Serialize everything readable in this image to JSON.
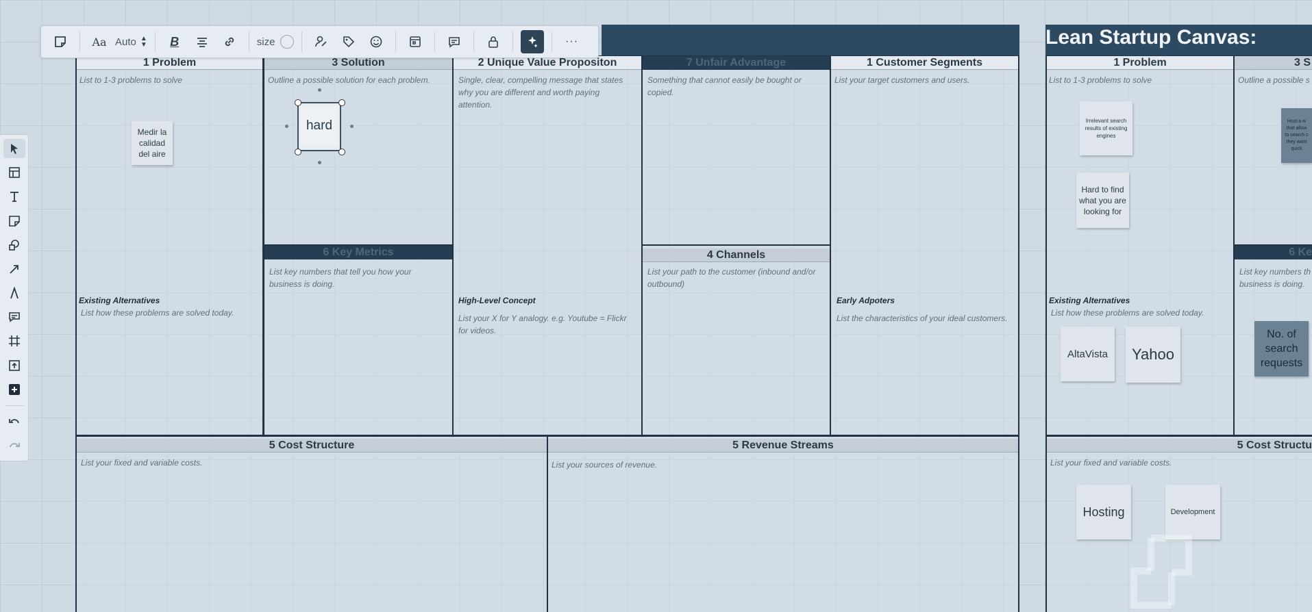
{
  "toolbar": {
    "font_label": "Aa",
    "auto_label": "Auto",
    "bold_label": "B",
    "size_label": "size",
    "more_label": "···"
  },
  "canvas_left": {
    "problem": {
      "title": "1 Problem",
      "hint": "List to 1-3 problems to solve"
    },
    "solution": {
      "title": "3 Solution",
      "hint": "Outline a possible solution for each problem."
    },
    "uvp": {
      "title": "2 Unique Value Propositon",
      "hint": "Single, clear, compelling message that states why  you are different and worth paying attention."
    },
    "unfair": {
      "title": "7 Unfair Advantage",
      "hint": "Something that cannot easily be bought or copied."
    },
    "segments": {
      "title": "1 Customer Segments",
      "hint": "List your target customers and users."
    },
    "metrics": {
      "title": "6 Key Metrics",
      "hint": "List key numbers that tell you how your business is doing."
    },
    "channels": {
      "title": "4 Channels",
      "hint": "List your path to the customer (inbound and/or outbound)"
    },
    "alternatives": {
      "title": "Existing Alternatives",
      "hint": "List how these problems are solved today."
    },
    "concept": {
      "title": "High-Level Concept",
      "hint": "List your X for Y analogy. e.g. Youtube = Flickr for videos."
    },
    "adopters": {
      "title": "Early Adpoters",
      "hint": "List the characteristics of your ideal customers."
    },
    "cost": {
      "title": "5 Cost Structure",
      "hint": "List your fixed and variable costs."
    },
    "revenue": {
      "title": "5 Revenue Streams",
      "hint": "List your sources of revenue."
    },
    "notes": {
      "medir": "Medir la calidad del aire",
      "hard": "hard"
    }
  },
  "canvas_right": {
    "title": "Lean Startup Canvas:",
    "problem": {
      "title": "1 Problem",
      "hint": "List to 1-3 problems to solve"
    },
    "solution": {
      "title": "3 S",
      "hint": "Outline a possible s"
    },
    "metrics": {
      "title": "6 Ke",
      "hint": "List key numbers th business is doing."
    },
    "alternatives": {
      "title": "Existing Alternatives",
      "hint": "List how these problems are solved today."
    },
    "cost": {
      "title": "5 Cost Structu",
      "hint": "List your fixed and variable costs."
    },
    "notes": {
      "irrelevant": "Irrelevant search results of existing engines",
      "hard_find": "Hard to find what you are looking for",
      "host": "Host a w that allow to search c they want quick",
      "altavista": "AltaVista",
      "yahoo": "Yahoo",
      "search_requests": "No. of search requests",
      "hosting": "Hosting",
      "development": "Development"
    }
  }
}
